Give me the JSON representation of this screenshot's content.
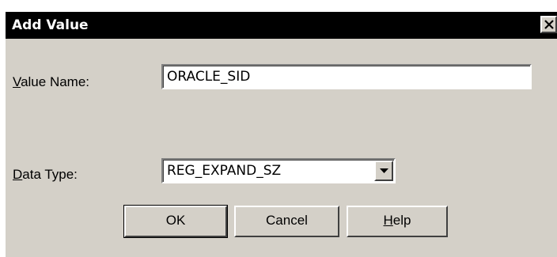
{
  "dialog": {
    "title": "Add Value",
    "close_symbol": "×"
  },
  "value_name": {
    "label_mnemonic": "V",
    "label_rest": "alue Name:",
    "value": "ORACLE_SID"
  },
  "data_type": {
    "label_mnemonic": "D",
    "label_rest": "ata Type:",
    "selected": "REG_EXPAND_SZ"
  },
  "buttons": {
    "ok": "OK",
    "cancel": "Cancel",
    "help_mnemonic": "H",
    "help_rest": "elp"
  },
  "colors": {
    "dialog_face": "#d4d0c8",
    "titlebar": "#000000",
    "title_text": "#ffffff",
    "field_bg": "#ffffff"
  },
  "icons": {
    "close": "close-icon",
    "dropdown": "chevron-down-icon"
  }
}
